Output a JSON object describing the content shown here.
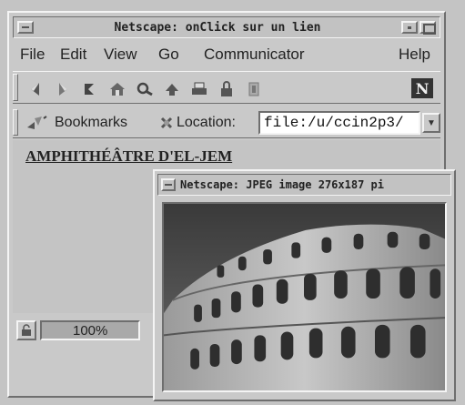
{
  "main_window": {
    "title": "Netscape: onClick sur un lien",
    "menu": [
      "File",
      "Edit",
      "View",
      "Go",
      "Communicator",
      "Help"
    ],
    "toolbar_icons": [
      "back-icon",
      "forward-icon",
      "reload-icon",
      "home-icon",
      "search-icon",
      "guide-icon",
      "print-icon",
      "security-icon",
      "stop-icon"
    ],
    "brand_logo": "N",
    "bookmarks_label": "Bookmarks",
    "location_label": "Location:",
    "location_value": "file:/u/ccin2p3/",
    "page_link": "AMPHITHÉÂTRE D'EL-JEM",
    "status_progress": "100%",
    "progress_fraction": 1.0
  },
  "image_window": {
    "title": "Netscape: JPEG image 276x187 pi"
  }
}
